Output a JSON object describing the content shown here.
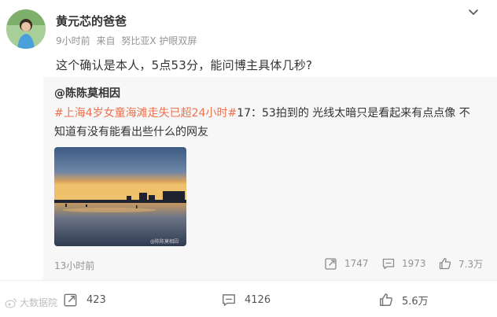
{
  "post": {
    "author": "黄元芯的爸爸",
    "time": "9小时前",
    "source_prefix": "来自",
    "source": "努比亚X 护眼双屏",
    "content": "这个确认是本人，5点53分，能问博主具体几秒?"
  },
  "repost": {
    "author": "@陈陈莫相因",
    "topic": "#上海4岁女童海滩走失已超24小时#",
    "text": "17：53拍到的   光线太暗只是看起来有点点像   不知道有没有能看出些什么的网友",
    "image_caption": "@陈陈莫相因",
    "time": "13小时前",
    "reposts": "1747",
    "comments": "1973",
    "likes": "7.3万"
  },
  "actions": {
    "reposts": "423",
    "comments": "4126",
    "likes": "5.6万"
  },
  "watermark": "大数据院",
  "icons": {
    "more": "chevron-down-icon",
    "repost": "repost-icon",
    "comment": "comment-icon",
    "like": "thumbs-up-icon"
  },
  "colors": {
    "topic": "#eb7350",
    "meta": "#939393",
    "repost_bg": "#f7f7f7"
  }
}
